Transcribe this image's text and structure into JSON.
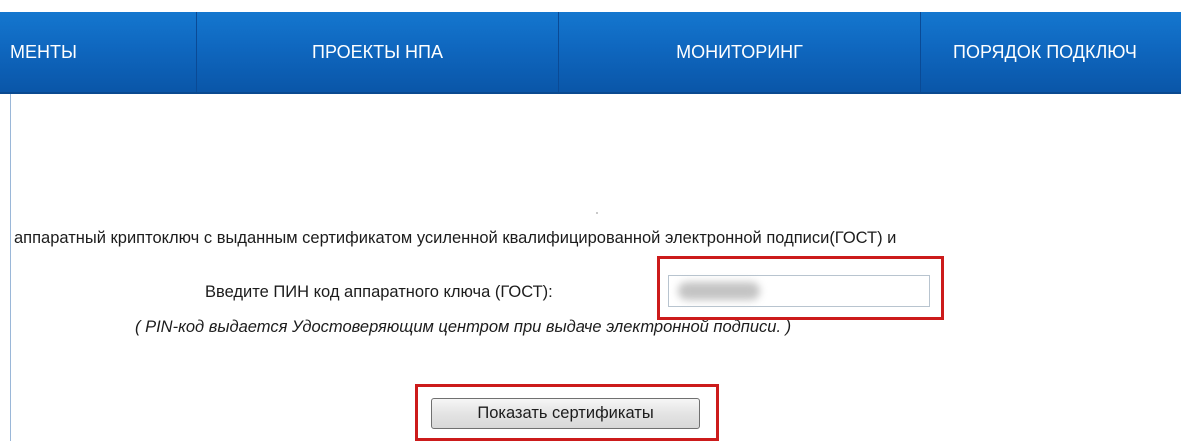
{
  "nav": {
    "items": [
      {
        "label": "МЕНТЫ"
      },
      {
        "label": "ПРОЕКТЫ НПА"
      },
      {
        "label": "МОНИТОРИНГ"
      },
      {
        "label": "ПОРЯДОК ПОДКЛЮЧ"
      }
    ]
  },
  "form": {
    "description": "аппаратный криптоключ с выданным сертификатом усиленной квалифицированной электронной подписи(ГОСТ) и",
    "pin_label": "Введите ПИН код аппаратного ключа (ГОСТ):",
    "pin_value_hidden": true,
    "pin_hint": "( PIN-код выдается Удостоверяющим центром при выдаче электронной подписи. )",
    "show_button_label": "Показать сертификаты"
  },
  "annotations": {
    "highlight_color": "#cc1b1b"
  },
  "colors": {
    "nav_background": "#0f67bf",
    "nav_text": "#ffffff"
  }
}
